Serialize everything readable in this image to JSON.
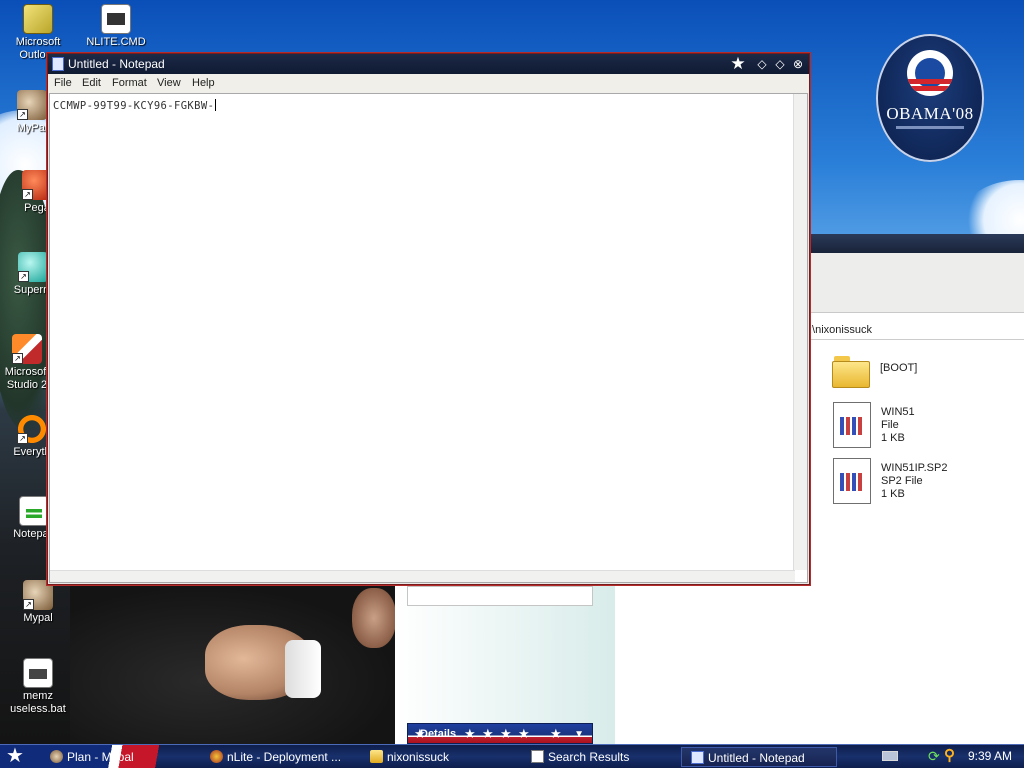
{
  "desktop": {
    "badge_text": "OBAMA'08",
    "icons": [
      {
        "label": "Microsoft\nOutlo…",
        "icon": "outlook-icon"
      },
      {
        "label": "NLITE.CMD",
        "icon": "cmd-file-icon"
      },
      {
        "label": "MyPal",
        "icon": "mypal-icon"
      },
      {
        "label": "Pega",
        "icon": "pegasus-icon"
      },
      {
        "label": "Superm",
        "icon": "supermium-icon"
      },
      {
        "label": "Microsoft\nStudio 2",
        "icon": "visual-studio-icon"
      },
      {
        "label": "Everyth",
        "icon": "everything-icon"
      },
      {
        "label": "Notepad",
        "icon": "notepad-icon"
      },
      {
        "label": "Mypal",
        "icon": "mypal-icon"
      },
      {
        "label": "memz\nuseless.bat",
        "icon": "bat-file-icon"
      }
    ]
  },
  "explorer": {
    "address": ":\\nixonissuck",
    "details_label": "Details",
    "files": [
      {
        "name": "[BOOT]",
        "type": "",
        "size": "",
        "icon": "folder-icon"
      },
      {
        "name": "WIN51",
        "type": "File",
        "size": "1 KB",
        "icon": "file-icon"
      },
      {
        "name": "WIN51IP.SP2",
        "type": "SP2 File",
        "size": "1 KB",
        "icon": "file-icon"
      }
    ]
  },
  "notepad": {
    "title": "Untitled - Notepad",
    "menu": [
      "File",
      "Edit",
      "Format",
      "View",
      "Help"
    ],
    "content": "CCMWP-99T99-KCY96-FGKBW-",
    "buttons": {
      "star": "★",
      "minimize": "◇",
      "maximize": "◇",
      "close": "⊗"
    }
  },
  "taskbar": {
    "start_glyph": "★",
    "items": [
      {
        "label": "Plan - Mypal",
        "icon": "mypal-icon"
      },
      {
        "label": "nLite - Deployment ...",
        "icon": "nlite-icon"
      },
      {
        "label": "nixonissuck",
        "icon": "folder-icon"
      },
      {
        "label": "Search Results",
        "icon": "search-results-icon"
      },
      {
        "label": "Untitled - Notepad",
        "icon": "notepad-icon",
        "active": true
      }
    ],
    "clock": "9:39 AM"
  },
  "colors": {
    "accent_red": "#c6162a",
    "accent_blue": "#0f2b7a",
    "title_bar": "#1d2a47"
  }
}
